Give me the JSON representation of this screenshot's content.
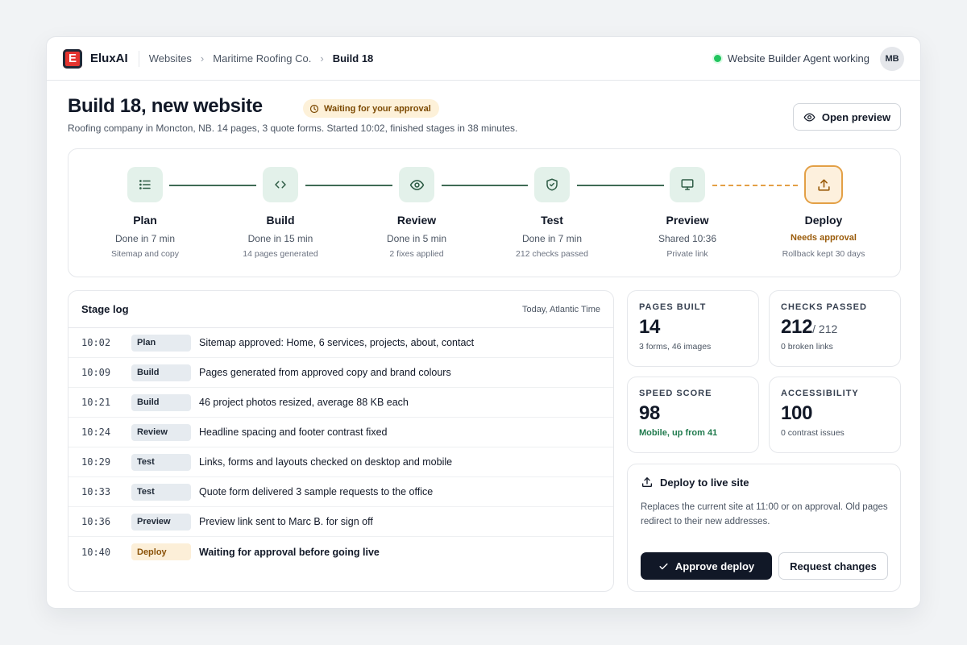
{
  "app": {
    "logo_letter": "E",
    "name": "EluxAI"
  },
  "breadcrumb": [
    "Websites",
    "Maritime Roofing Co.",
    "Build 18"
  ],
  "agent_status": {
    "text": "Website Builder Agent working",
    "color": "#22c55e"
  },
  "user": {
    "initials": "MB"
  },
  "header": {
    "title": "Build 18, new website",
    "badge": "Waiting for your approval",
    "subtitle": "Roofing company in Moncton, NB. 14 pages, 3 quote forms. Started 10:02, finished stages in 38 minutes.",
    "preview_button": "Open preview"
  },
  "pipeline": [
    {
      "name": "Plan",
      "status": "Done in 7 min",
      "detail": "Sitemap and copy",
      "icon": "list-icon"
    },
    {
      "name": "Build",
      "status": "Done in 15 min",
      "detail": "14 pages generated",
      "icon": "code-icon"
    },
    {
      "name": "Review",
      "status": "Done in 5 min",
      "detail": "2 fixes applied",
      "icon": "eye-icon"
    },
    {
      "name": "Test",
      "status": "Done in 7 min",
      "detail": "212 checks passed",
      "icon": "shield-check-icon"
    },
    {
      "name": "Preview",
      "status": "Shared 10:36",
      "detail": "Private link",
      "icon": "monitor-icon"
    },
    {
      "name": "Deploy",
      "status": "Needs approval",
      "detail": "Rollback kept 30 days",
      "icon": "upload-icon"
    }
  ],
  "stage_log": {
    "title": "Stage log",
    "date_label": "Today, Atlantic Time",
    "rows": [
      {
        "time": "10:02",
        "stage": "Plan",
        "message": "Sitemap approved: Home, 6 services, projects, about, contact"
      },
      {
        "time": "10:09",
        "stage": "Build",
        "message": "Pages generated from approved copy and brand colours"
      },
      {
        "time": "10:21",
        "stage": "Build",
        "message": "46 project photos resized, average 88 KB each"
      },
      {
        "time": "10:24",
        "stage": "Review",
        "message": "Headline spacing and footer contrast fixed"
      },
      {
        "time": "10:29",
        "stage": "Test",
        "message": "Links, forms and layouts checked on desktop and mobile"
      },
      {
        "time": "10:33",
        "stage": "Test",
        "message": "Quote form delivered 3 sample requests to the office"
      },
      {
        "time": "10:36",
        "stage": "Preview",
        "message": "Preview link sent to Marc B. for sign off"
      },
      {
        "time": "10:40",
        "stage": "Deploy",
        "message": "Waiting for approval before going live"
      }
    ]
  },
  "metrics": {
    "pages_built": {
      "label": "PAGES BUILT",
      "value": "14",
      "note": "3 forms, 46 images"
    },
    "checks_passed": {
      "label": "CHECKS PASSED",
      "value": "212",
      "total": "/ 212",
      "note": "0 broken links"
    },
    "speed_score": {
      "label": "SPEED SCORE",
      "value": "98",
      "note": "Mobile, up from 41"
    },
    "accessibility": {
      "label": "ACCESSIBILITY",
      "value": "100",
      "note": "0 contrast issues"
    }
  },
  "deploy_card": {
    "title": "Deploy to live site",
    "description": "Replaces the current site at 11:00 or on approval. Old pages redirect to their new addresses.",
    "approve_label": "Approve deploy",
    "changes_label": "Request changes"
  },
  "colors": {
    "accent_dark": "#111827",
    "done_green": "#3f6b55",
    "warn_amber": "#e3a046",
    "brand_red": "#e3342f"
  }
}
